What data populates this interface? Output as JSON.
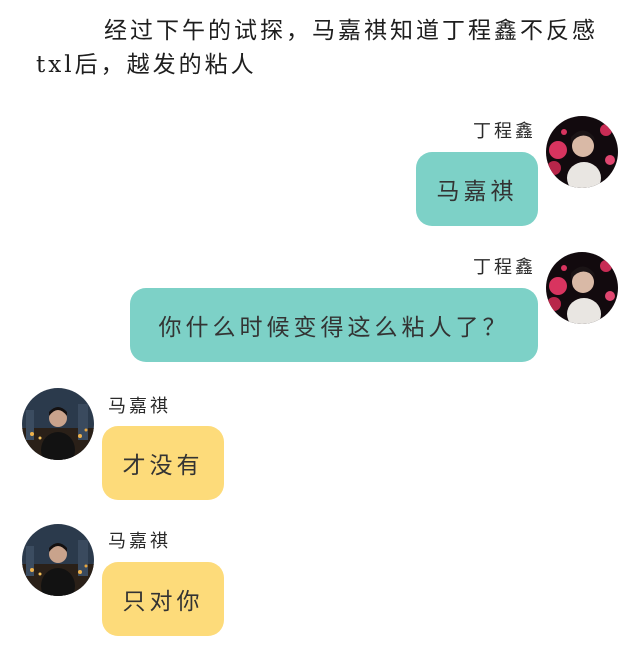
{
  "narration": "经过下午的试探，马嘉祺知道丁程鑫不反感txl后，越发的粘人",
  "colors": {
    "right_bubble": "#7dd1c7",
    "left_bubble": "#fddb7a"
  },
  "messages": [
    {
      "sender": "丁程鑫",
      "text": "马嘉祺",
      "side": "right"
    },
    {
      "sender": "丁程鑫",
      "text": "你什么时候变得这么粘人了？",
      "side": "right"
    },
    {
      "sender": "马嘉祺",
      "text": "才没有",
      "side": "left"
    },
    {
      "sender": "马嘉祺",
      "text": "只对你",
      "side": "left"
    }
  ]
}
